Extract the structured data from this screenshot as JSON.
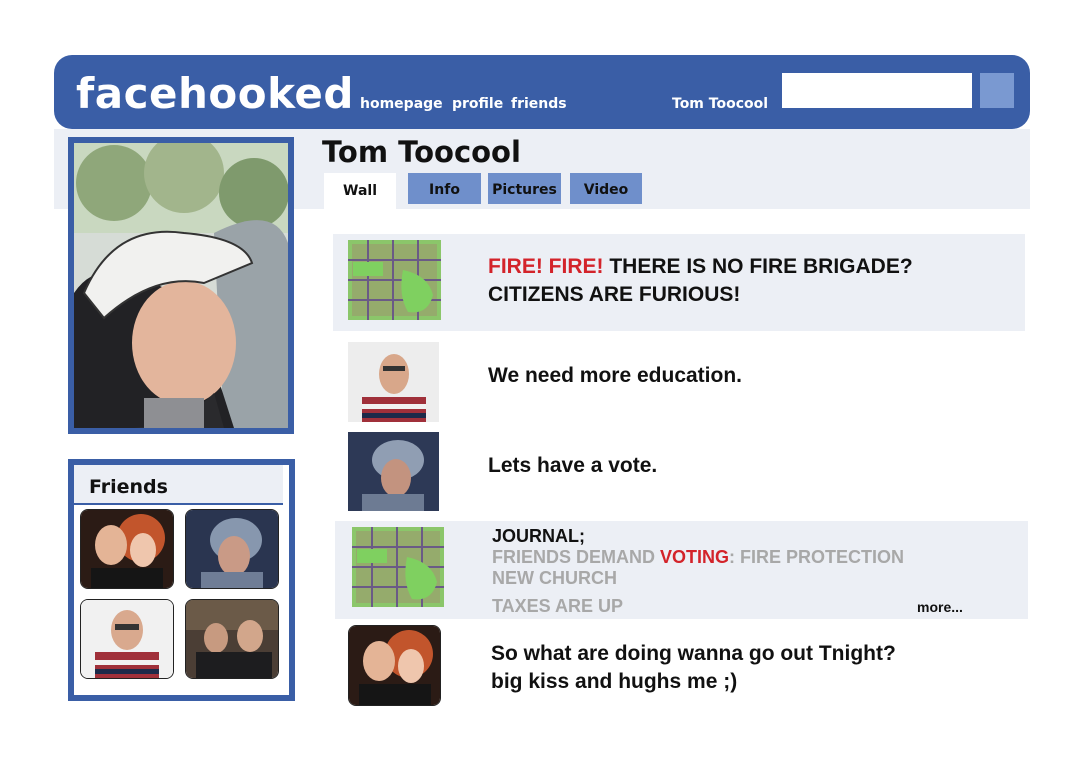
{
  "app": {
    "logo": "facehooked",
    "nav": [
      "homepage",
      "profile",
      "friends"
    ],
    "current_user": "Tom Toocool",
    "search": {
      "value": "",
      "placeholder": ""
    },
    "colors": {
      "brand": "#3a5ea6",
      "tab": "#6f8fcb",
      "panel": "#eceff5",
      "alert": "#d3232a",
      "muted": "#a8a8a8"
    }
  },
  "profile": {
    "name": "Tom Toocool",
    "tabs": [
      "Wall",
      "Info",
      "Pictures",
      "Video"
    ],
    "active_tab": "Wall"
  },
  "friends": {
    "title": "Friends",
    "thumbs": [
      "friend-two-women",
      "friend-smoker",
      "friend-glasses",
      "friend-bar"
    ]
  },
  "wall": {
    "posts": [
      {
        "line1_red": "FIRE! FIRE!",
        "line1_rest": " THERE IS NO FIRE BRIGADE?",
        "line2": "CITIZENS ARE FURIOUS!"
      },
      {
        "text": "We need more education."
      },
      {
        "text": "Lets have a vote."
      },
      {
        "heading": "JOURNAL;",
        "line1_a": "FRIENDS DEMAND ",
        "line1_red": "VOTING",
        "line1_b": ": FIRE PROTECTION",
        "line2": "NEW CHURCH",
        "line3": "TAXES ARE UP",
        "more": "more..."
      },
      {
        "line1": "So what are doing wanna go out Tnight?",
        "line2": "big kiss and hughs me ;)"
      }
    ]
  }
}
